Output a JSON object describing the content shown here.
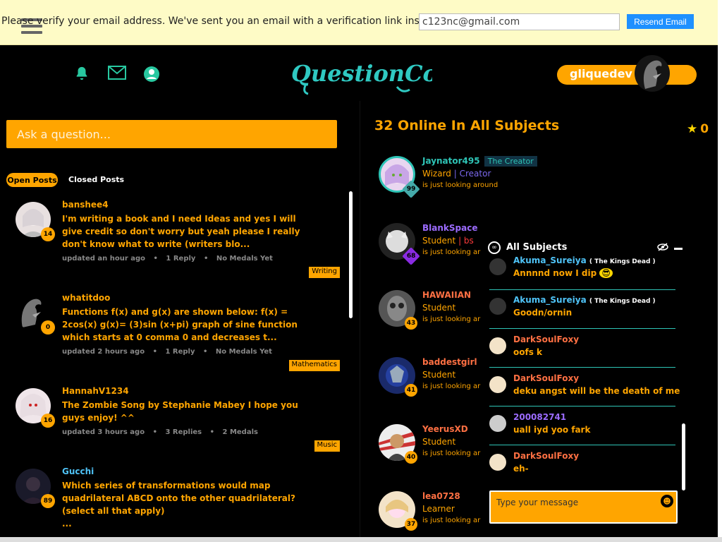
{
  "verify": {
    "message": "Please verify your email address. We've sent you an email with a verification link inside.",
    "email_value": "c123nc@gmail.com",
    "resend_label": "Resend Email"
  },
  "header": {
    "logo_text": "QuestionCove",
    "username": "gliquedev"
  },
  "ask": {
    "placeholder": "Ask a question..."
  },
  "post_tabs": {
    "open": "Open Posts",
    "closed": "Closed Posts"
  },
  "posts": [
    {
      "user": "banshee4",
      "level": "14",
      "text": "I'm writing a book and I need Ideas and yes I will give credit so don't worry but yeah please I really don't know what to write (writers blo...",
      "updated": "updated an hour ago",
      "replies": "1 Reply",
      "medals": "No Medals Yet",
      "tag": "Writing"
    },
    {
      "user": "whatitdoo",
      "level": "0",
      "text": "Functions f(x) and g(x) are shown below: f(x) = 2cos(x) g(x)= (3)sin (x+pi) graph of sine function which starts at 0 comma 0 and decreases t...",
      "updated": "updated 2 hours ago",
      "replies": "1 Reply",
      "medals": "No Medals Yet",
      "tag": "Mathematics"
    },
    {
      "user": "HannahV1234",
      "level": "16",
      "text": "The Zombie Song by Stephanie Mabey I hope you guys enjoy! ^^",
      "updated": "updated 3 hours ago",
      "replies": "3 Replies",
      "medals": "2 Medals",
      "tag": "Music"
    },
    {
      "user": "Gucchi",
      "level": "89",
      "text": "Which series of transformations would map quadrilateral ABCD onto the other quadrilateral? (select all that apply)",
      "extra": "...",
      "updated": "",
      "replies": "",
      "medals": "",
      "tag": ""
    }
  ],
  "online": {
    "title": "32 Online In All Subjects",
    "medal_count": "0",
    "users": [
      {
        "name": "Jaynator495",
        "title_badge": "The Creator",
        "role": "Wizard",
        "role2": "| Creator",
        "status": "is just looking around",
        "level": "99"
      },
      {
        "name": "BlankSpace",
        "role": "Student",
        "role2": "| bs",
        "status": "is just looking ar",
        "level": "68"
      },
      {
        "name": "HAWAIIAN",
        "role": "Student",
        "status": "is just looking ar",
        "level": "43"
      },
      {
        "name": "baddestgirl",
        "role": "Student",
        "status": "is just looking ar",
        "level": "41"
      },
      {
        "name": "YeerusXD",
        "role": "Student",
        "status": "is just looking ar",
        "level": "40"
      },
      {
        "name": "lea0728",
        "role": "Learner",
        "status": "is just looking ar",
        "level": "37"
      }
    ]
  },
  "chat": {
    "title": "All Subjects",
    "messages": [
      {
        "user": "Akuma_Sureiya",
        "tag": "( The Kings Dead )",
        "text": "Annnnd now I dip",
        "user_color": "#4fc3f7"
      },
      {
        "user": "Akuma_Sureiya",
        "tag": "( The Kings Dead )",
        "text": "Goodn/ornin",
        "user_color": "#4fc3f7"
      },
      {
        "user": "DarkSoulFoxy",
        "text": "oofs k",
        "user_color": "#ff7043"
      },
      {
        "user": "DarkSoulFoxy",
        "text": "deku angst will be the death of me",
        "user_color": "#ff7043"
      },
      {
        "user": "200082741",
        "text": "uall iyd yoo fark",
        "user_color": "#9c6cff"
      },
      {
        "user": "DarkSoulFoxy",
        "text": "eh-",
        "user_color": "#ff7043"
      }
    ],
    "input_placeholder": "Type your message"
  },
  "colors": {
    "accent": "#ffa500",
    "teal": "#2ec4b6",
    "verify_bg": "#fefbc6",
    "link_blue": "#1e90ff"
  }
}
